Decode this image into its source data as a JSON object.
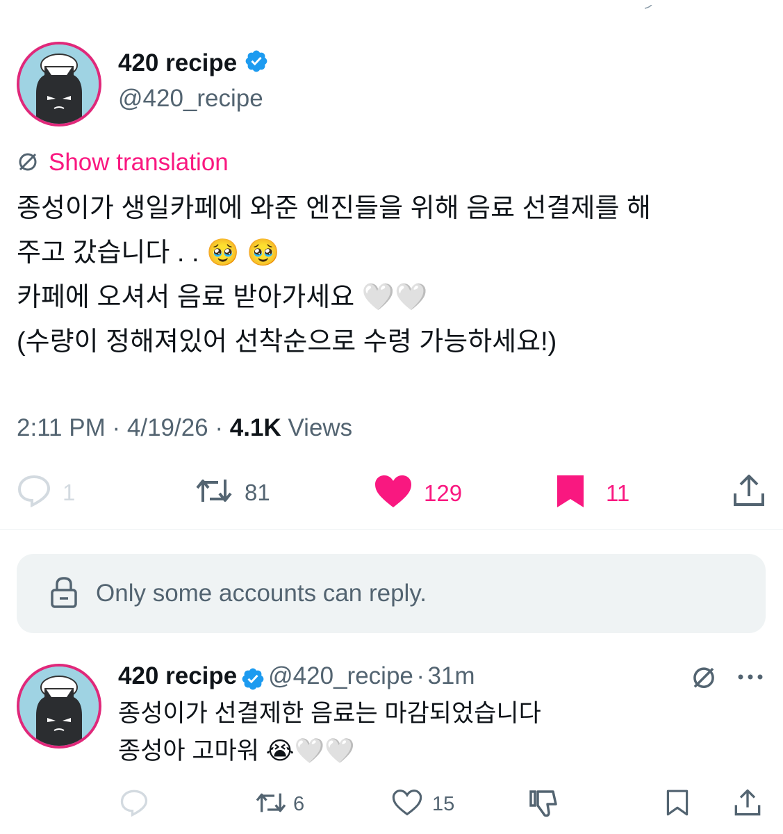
{
  "tweet": {
    "author_name": "420 recipe",
    "author_handle": "@420_recipe",
    "show_translation": "Show translation",
    "text_lines": [
      "종성이가 생일카페에 와준 엔진들을 위해 음료 선결제를 해",
      "주고 갔습니다 . . 🥹 🥹",
      "카페에 오셔서 음료 받아가세요 🤍🤍",
      "(수량이 정해져있어 선착순으로 수령 가능하세요!)"
    ],
    "time": "2:11 PM",
    "date": "4/19/26",
    "views_count": "4.1K",
    "views_label": "Views",
    "separator": "·",
    "replies": "1",
    "reposts": "81",
    "likes": "129",
    "bookmarks": "11"
  },
  "reply_restriction": {
    "text": "Only some accounts can reply."
  },
  "reply": {
    "author_name": "420 recipe",
    "author_handle": "@420_recipe",
    "time_ago": "31m",
    "separator": "·",
    "text_lines": [
      "종성이가 선결제한 음료는 마감되었습니다",
      "종성아 고마워 😭🤍🤍"
    ],
    "reposts": "6",
    "likes": "15"
  },
  "colors": {
    "accent_pink": "#f91880",
    "verified_blue": "#1d9bf0",
    "muted": "#536471"
  }
}
